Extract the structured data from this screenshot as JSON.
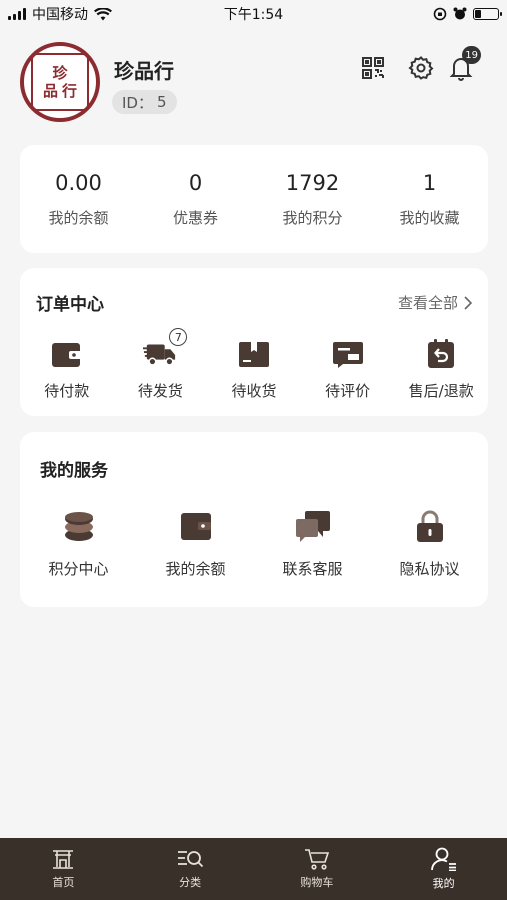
{
  "status_bar": {
    "carrier": "中国移动",
    "time": "下午1:54"
  },
  "profile": {
    "avatar_text": [
      "珍",
      "品",
      "行"
    ],
    "name": "珍品行",
    "id_label": "ID：",
    "id_value": "5",
    "notification_count": "19"
  },
  "stats": [
    {
      "value": "0.00",
      "label": "我的余额"
    },
    {
      "value": "0",
      "label": "优惠券"
    },
    {
      "value": "1792",
      "label": "我的积分"
    },
    {
      "value": "1",
      "label": "我的收藏"
    }
  ],
  "orders": {
    "title": "订单中心",
    "view_all": "查看全部",
    "items": [
      {
        "label": "待付款",
        "icon": "wallet-icon"
      },
      {
        "label": "待发货",
        "icon": "delivery-truck-icon",
        "badge": "7"
      },
      {
        "label": "待收货",
        "icon": "package-box-icon"
      },
      {
        "label": "待评价",
        "icon": "review-card-icon"
      },
      {
        "label": "售后/退款",
        "icon": "refund-return-icon"
      }
    ]
  },
  "services": {
    "title": "我的服务",
    "items": [
      {
        "label": "积分中心",
        "icon": "coins-stack-icon"
      },
      {
        "label": "我的余额",
        "icon": "wallet-icon"
      },
      {
        "label": "联系客服",
        "icon": "chat-bubbles-icon"
      },
      {
        "label": "隐私协议",
        "icon": "lock-icon"
      }
    ]
  },
  "tabbar": [
    {
      "label": "首页",
      "icon": "home-gate-icon"
    },
    {
      "label": "分类",
      "icon": "category-search-icon"
    },
    {
      "label": "购物车",
      "icon": "cart-icon"
    },
    {
      "label": "我的",
      "icon": "user-icon",
      "active": true
    }
  ],
  "colors": {
    "brand": "#8c2b30",
    "icon_dark": "#4a3a34",
    "tabbar_bg": "#3a302a"
  }
}
